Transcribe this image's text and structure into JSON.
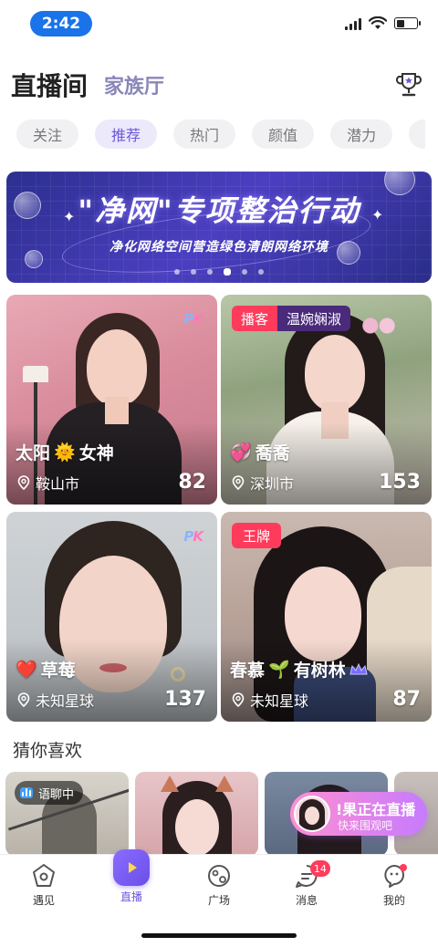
{
  "status_bar": {
    "time": "2:42",
    "battery_level": 0.4
  },
  "header": {
    "title": "直播间",
    "subtitle": "家族厅",
    "trophy_icon": "trophy-icon"
  },
  "tabs": [
    {
      "label": "关注",
      "active": false
    },
    {
      "label": "推荐",
      "active": true
    },
    {
      "label": "热门",
      "active": false
    },
    {
      "label": "颜值",
      "active": false
    },
    {
      "label": "潜力",
      "active": false
    }
  ],
  "banner": {
    "title": "\"净网\"专项整治行动",
    "subtitle": "净化网络空间营造绿色清朗网络环境",
    "page_index": 4,
    "page_count": 6
  },
  "cards": [
    {
      "name_before": "太阳",
      "emoji": "🌞",
      "name_after": "女神",
      "location": "鞍山市",
      "count": "82",
      "pk": "PK"
    },
    {
      "tag_red": "播客",
      "tag_dark": "温婉娴淑",
      "emoji": "💞",
      "name_after": "喬喬",
      "location": "深圳市",
      "count": "153"
    },
    {
      "emoji": "❤️",
      "name_after": "草莓",
      "location": "未知星球",
      "count": "137",
      "pk": "PK"
    },
    {
      "tag_single": "王牌",
      "name_before": "春慕",
      "emoji": "🌱",
      "name_after": "有树林",
      "location": "未知星球",
      "count": "87"
    }
  ],
  "section": {
    "guess_title": "猜你喜欢",
    "voice_badge": "语聊中"
  },
  "live_float": {
    "text1": "!果正在直播",
    "text2": "快来围观吧"
  },
  "tabbar": [
    {
      "label": "遇见",
      "icon": "home-icon",
      "active": false
    },
    {
      "label": "直播",
      "icon": "play-icon",
      "active": true
    },
    {
      "label": "广场",
      "icon": "planet-icon",
      "active": false
    },
    {
      "label": "消息",
      "icon": "message-icon",
      "active": false,
      "badge": "14"
    },
    {
      "label": "我的",
      "icon": "profile-icon",
      "active": false,
      "dot": true
    }
  ]
}
